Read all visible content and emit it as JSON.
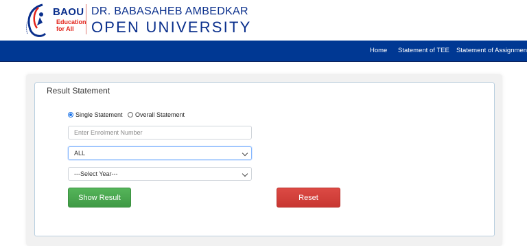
{
  "header": {
    "logo_text": "BAOU",
    "logo_tagline_1": "Education",
    "logo_tagline_2": "for All",
    "university_line1": "DR. BABASAHEB AMBEDKAR",
    "university_line2": "OPEN UNIVERSITY"
  },
  "nav": {
    "items": [
      {
        "label": "Home"
      },
      {
        "label": "Statement of TEE"
      },
      {
        "label": "Statement of Assignment"
      }
    ]
  },
  "panel": {
    "title": "Result Statement",
    "radio_options": [
      {
        "label": "Single Statement",
        "checked": true
      },
      {
        "label": "Overall Statement",
        "checked": false
      }
    ],
    "enrolment_placeholder": "Enter Enrolment Number",
    "enrolment_value": "",
    "type_select_value": "ALL",
    "year_select_value": "---Select Year---",
    "show_button": "Show Result",
    "reset_button": "Reset"
  },
  "colors": {
    "nav_bg": "#003893",
    "brand_blue": "#0a2f8c",
    "brand_red": "#e2231a",
    "show_button": "#4caf50",
    "reset_button": "#d9403a"
  },
  "icons": [
    "university-logo-icon",
    "chevron-down-icon"
  ]
}
